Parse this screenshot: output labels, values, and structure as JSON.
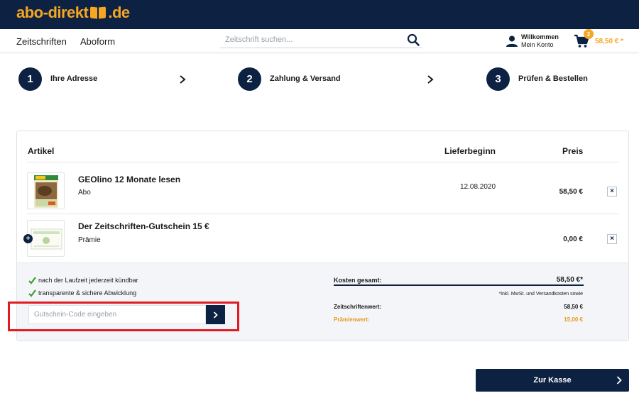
{
  "brand": {
    "logo_left": "abo-direkt",
    "logo_right": ".de",
    "color": "#f5a623",
    "bar_color": "#0d2142"
  },
  "nav": {
    "links": [
      "Zeitschriften",
      "Aboform"
    ],
    "search_placeholder": "Zeitschrift suchen...",
    "account_line1": "Willkommen",
    "account_line2": "Mein Konto",
    "cart_count": "2",
    "cart_total": "58,50 € *"
  },
  "steps": [
    {
      "number": "1",
      "label": "Ihre Adresse"
    },
    {
      "number": "2",
      "label": "Zahlung & Versand"
    },
    {
      "number": "3",
      "label": "Prüfen & Bestellen"
    }
  ],
  "table": {
    "col_article": "Artikel",
    "col_delivery": "Lieferbeginn",
    "col_price": "Preis"
  },
  "items": [
    {
      "title": "GEOlino 12 Monate lesen",
      "type": "Abo",
      "delivery": "12.08.2020",
      "price": "58,50 €",
      "remove": "×"
    },
    {
      "title": "Der Zeitschriften-Gutschein 15 €",
      "type": "Prämie",
      "delivery": "",
      "price": "0,00 €",
      "remove": "×"
    }
  ],
  "benefits": [
    "nach der Laufzeit jederzeit kündbar",
    "transparente & sichere Abwicklung"
  ],
  "voucher": {
    "placeholder": "Gutschein-Code eingeben"
  },
  "summary": {
    "total_label": "Kosten gesamt:",
    "total_value": "58,50 €*",
    "note": "*inkl. MwSt. und Versandkosten sowie",
    "magazine_label": "Zeitschriftenwert:",
    "magazine_value": "58,50 €",
    "premium_label": "Prämienwert:",
    "premium_value": "15,00 €",
    "premium_color": "#e89a1b"
  },
  "checkout": {
    "label": "Zur Kasse"
  }
}
